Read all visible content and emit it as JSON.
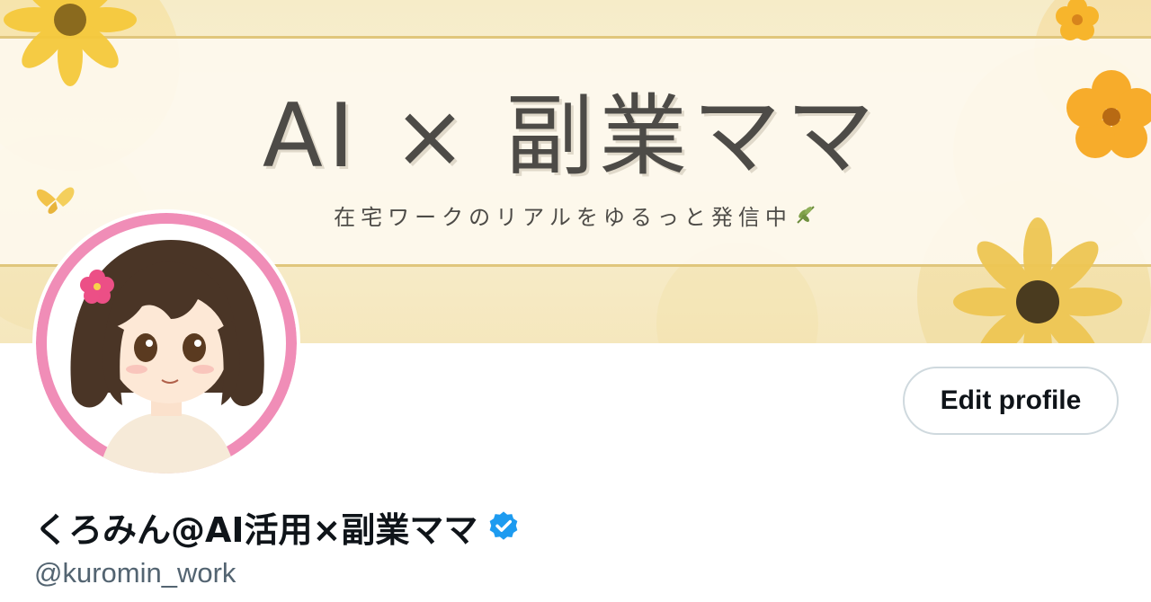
{
  "banner": {
    "title": "AI × 副業ママ",
    "subtitle": "在宅ワークのリアルをゆるっと発信中",
    "leaf_icon": "leaf-icon"
  },
  "profile": {
    "avatar_icon": "avatar",
    "edit_button_label": "Edit profile",
    "display_name": "くろみん@AI活用×副業ママ",
    "verified_icon": "verified-badge-icon",
    "handle": "@kuromin_work"
  },
  "colors": {
    "verified_blue": "#1d9bf0",
    "handle_gray": "#536471",
    "name_text": "#0f1419",
    "avatar_ring": "#f08db7",
    "button_border": "#cfd9de"
  }
}
